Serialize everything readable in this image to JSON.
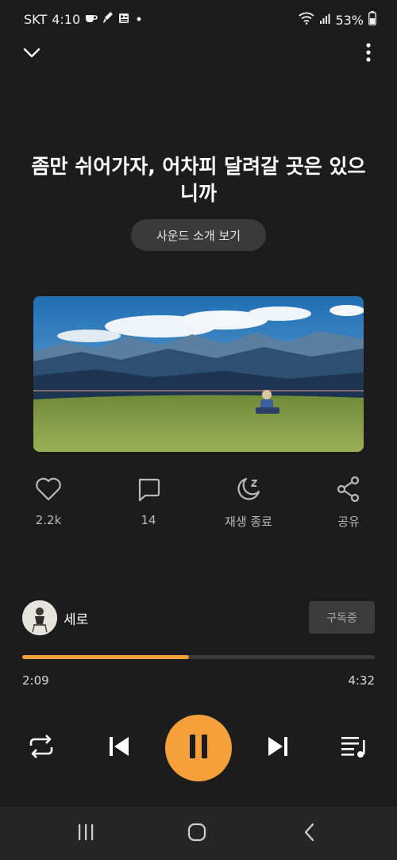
{
  "status_bar": {
    "carrier": "SKT",
    "time": "4:10",
    "battery": "53%",
    "icons": [
      "coffee-icon",
      "paint-icon",
      "news-icon",
      "dot-icon",
      "wifi-icon",
      "signal-icon",
      "battery-icon"
    ]
  },
  "header": {
    "collapse_icon": "chevron-down-icon",
    "more_icon": "more-vertical-icon"
  },
  "track": {
    "title": "좀만 쉬어가자, 어차피 달려갈 곳은 있으니까",
    "intro_button": "사운드 소개 보기"
  },
  "actions": [
    {
      "icon": "heart-icon",
      "label": "2.2k"
    },
    {
      "icon": "comment-icon",
      "label": "14"
    },
    {
      "icon": "sleep-timer-icon",
      "label": "재생 종료"
    },
    {
      "icon": "share-icon",
      "label": "공유"
    }
  ],
  "channel": {
    "name": "세로",
    "subscribe_label": "구독중"
  },
  "progress": {
    "current": "2:09",
    "total": "4:32",
    "fraction": 0.474
  },
  "controls": {
    "repeat_icon": "repeat-icon",
    "prev_icon": "skip-previous-icon",
    "play_state_icon": "pause-icon",
    "next_icon": "skip-next-icon",
    "playlist_icon": "playlist-icon"
  },
  "nav_bar": {
    "icons": [
      "recent-apps-icon",
      "home-icon",
      "back-icon"
    ]
  },
  "colors": {
    "background": "#1c1c1c",
    "accent": "#f5a03a",
    "button_bg": "#3a3a3a"
  }
}
